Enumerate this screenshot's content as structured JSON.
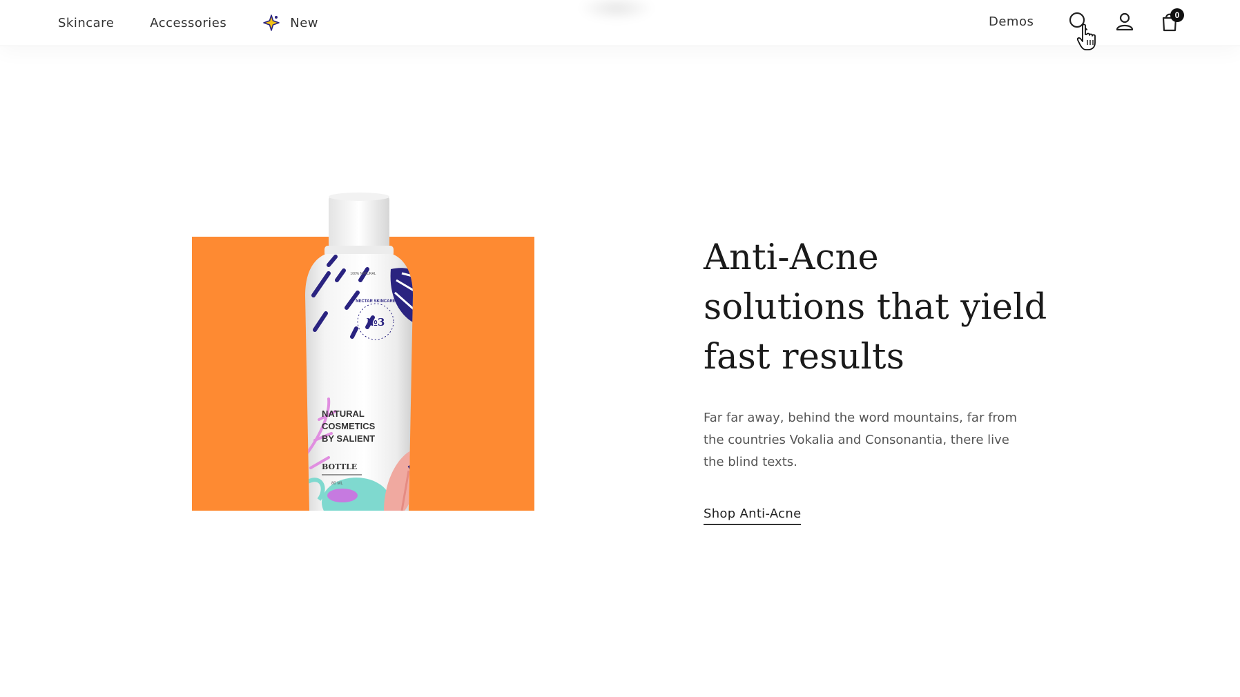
{
  "header": {
    "nav_left": [
      {
        "label": "Skincare"
      },
      {
        "label": "Accessories"
      },
      {
        "label": "New",
        "icon": "sparkle-icon"
      }
    ],
    "demos_label": "Demos",
    "icons": {
      "search": "search-icon",
      "account": "user-icon",
      "cart": "shopping-bag-icon"
    },
    "cart_count": "0"
  },
  "hero": {
    "title_lines": [
      "Anti-Acne",
      "solutions that yield",
      "fast results"
    ],
    "description": "Far far away, behind the word mountains, far from the countries Vokalia and Consonantia, there live the blind texts.",
    "cta_label": "Shop Anti-Acne",
    "bottle": {
      "badge": "№3",
      "ring_text": "NECTAR SKINCARE",
      "small_text": "100% NATURAL",
      "label_lines": [
        "NATURAL",
        "COSMETICS",
        "BY SALIENT"
      ],
      "bottle_label": "BOTTLE",
      "size": "80 ML"
    }
  },
  "colors": {
    "accent_orange": "#fe8a32",
    "navy": "#2a2380",
    "text_dark": "#1a1a1a",
    "text_body": "#555555"
  }
}
